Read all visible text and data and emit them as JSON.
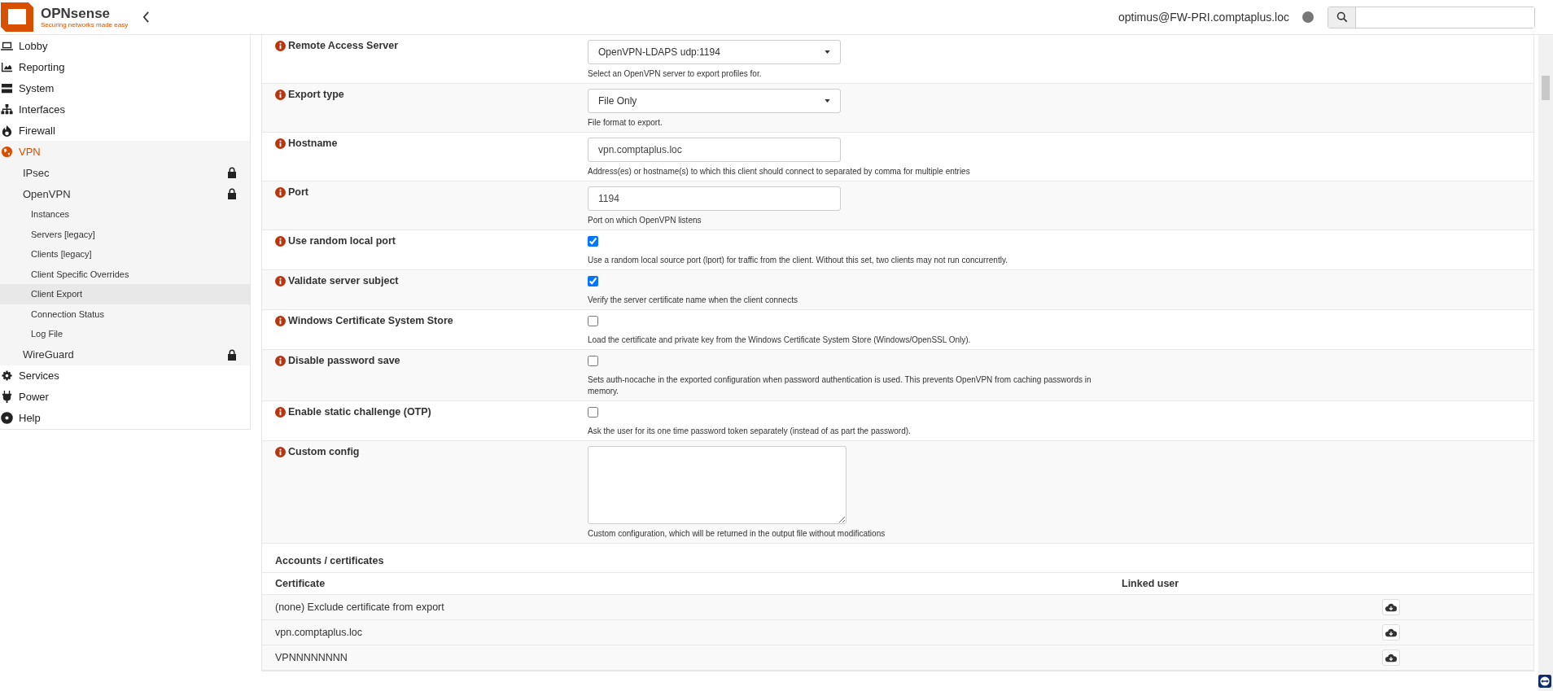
{
  "header": {
    "logo": "OPNsense",
    "tagline": "Securing networks made easy",
    "user": "optimus@FW-PRI.comptaplus.loc"
  },
  "sidebar": {
    "items": [
      {
        "label": "Lobby",
        "selected": false
      },
      {
        "label": "Reporting",
        "selected": false
      },
      {
        "label": "System",
        "selected": false
      },
      {
        "label": "Interfaces",
        "selected": false
      },
      {
        "label": "Firewall",
        "selected": false
      },
      {
        "label": "VPN",
        "selected": true,
        "expanded": true,
        "children": [
          {
            "label": "IPsec",
            "locked": true,
            "selected": false
          },
          {
            "label": "OpenVPN",
            "locked": true,
            "selected": false,
            "children": [
              {
                "label": "Instances",
                "selected": false
              },
              {
                "label": "Servers [legacy]",
                "selected": false
              },
              {
                "label": "Clients [legacy]",
                "selected": false
              },
              {
                "label": "Client Specific Overrides",
                "selected": false
              },
              {
                "label": "Client Export",
                "selected": true
              },
              {
                "label": "Connection Status",
                "selected": false
              },
              {
                "label": "Log File",
                "selected": false
              }
            ]
          },
          {
            "label": "WireGuard",
            "locked": true,
            "selected": false
          }
        ]
      },
      {
        "label": "Services",
        "selected": false
      },
      {
        "label": "Power",
        "selected": false
      },
      {
        "label": "Help",
        "selected": false
      }
    ]
  },
  "form": {
    "rows": [
      {
        "label": "Remote Access Server",
        "kind": "select",
        "value": "OpenVPN-LDAPS udp:1194",
        "help": "Select an OpenVPN server to export profiles for."
      },
      {
        "label": "Export type",
        "kind": "select",
        "value": "File Only",
        "help": "File format to export."
      },
      {
        "label": "Hostname",
        "kind": "text",
        "value": "vpn.comptaplus.loc",
        "help": "Address(es) or hostname(s) to which this client should connect to separated by comma for multiple entries"
      },
      {
        "label": "Port",
        "kind": "text",
        "value": "1194",
        "help": "Port on which OpenVPN listens"
      },
      {
        "label": "Use random local port",
        "kind": "checkbox",
        "checked": true,
        "help": "Use a random local source port (lport) for traffic from the client. Without this set, two clients may not run concurrently."
      },
      {
        "label": "Validate server subject",
        "kind": "checkbox",
        "checked": true,
        "help": "Verify the server certificate name when the client connects"
      },
      {
        "label": "Windows Certificate System Store",
        "kind": "checkbox",
        "checked": false,
        "help": "Load the certificate and private key from the Windows Certificate System Store (Windows/OpenSSL Only)."
      },
      {
        "label": "Disable password save",
        "kind": "checkbox",
        "checked": false,
        "help": "Sets auth-nocache in the exported configuration when password authentication is used. This prevents OpenVPN from caching passwords in memory."
      },
      {
        "label": "Enable static challenge (OTP)",
        "kind": "checkbox",
        "checked": false,
        "help": "Ask the user for its one time password token separately (instead of as part the password)."
      },
      {
        "label": "Custom config",
        "kind": "textarea",
        "help": "Custom configuration, which will be returned in the output file without modifications"
      }
    ]
  },
  "accounts": {
    "title": "Accounts / certificates",
    "columns": [
      "Certificate",
      "Linked user"
    ],
    "rows": [
      {
        "certificate": "(none) Exclude certificate from export"
      },
      {
        "certificate": "vpn.comptaplus.loc"
      },
      {
        "certificate": "VPNNNNNNNN"
      }
    ]
  }
}
